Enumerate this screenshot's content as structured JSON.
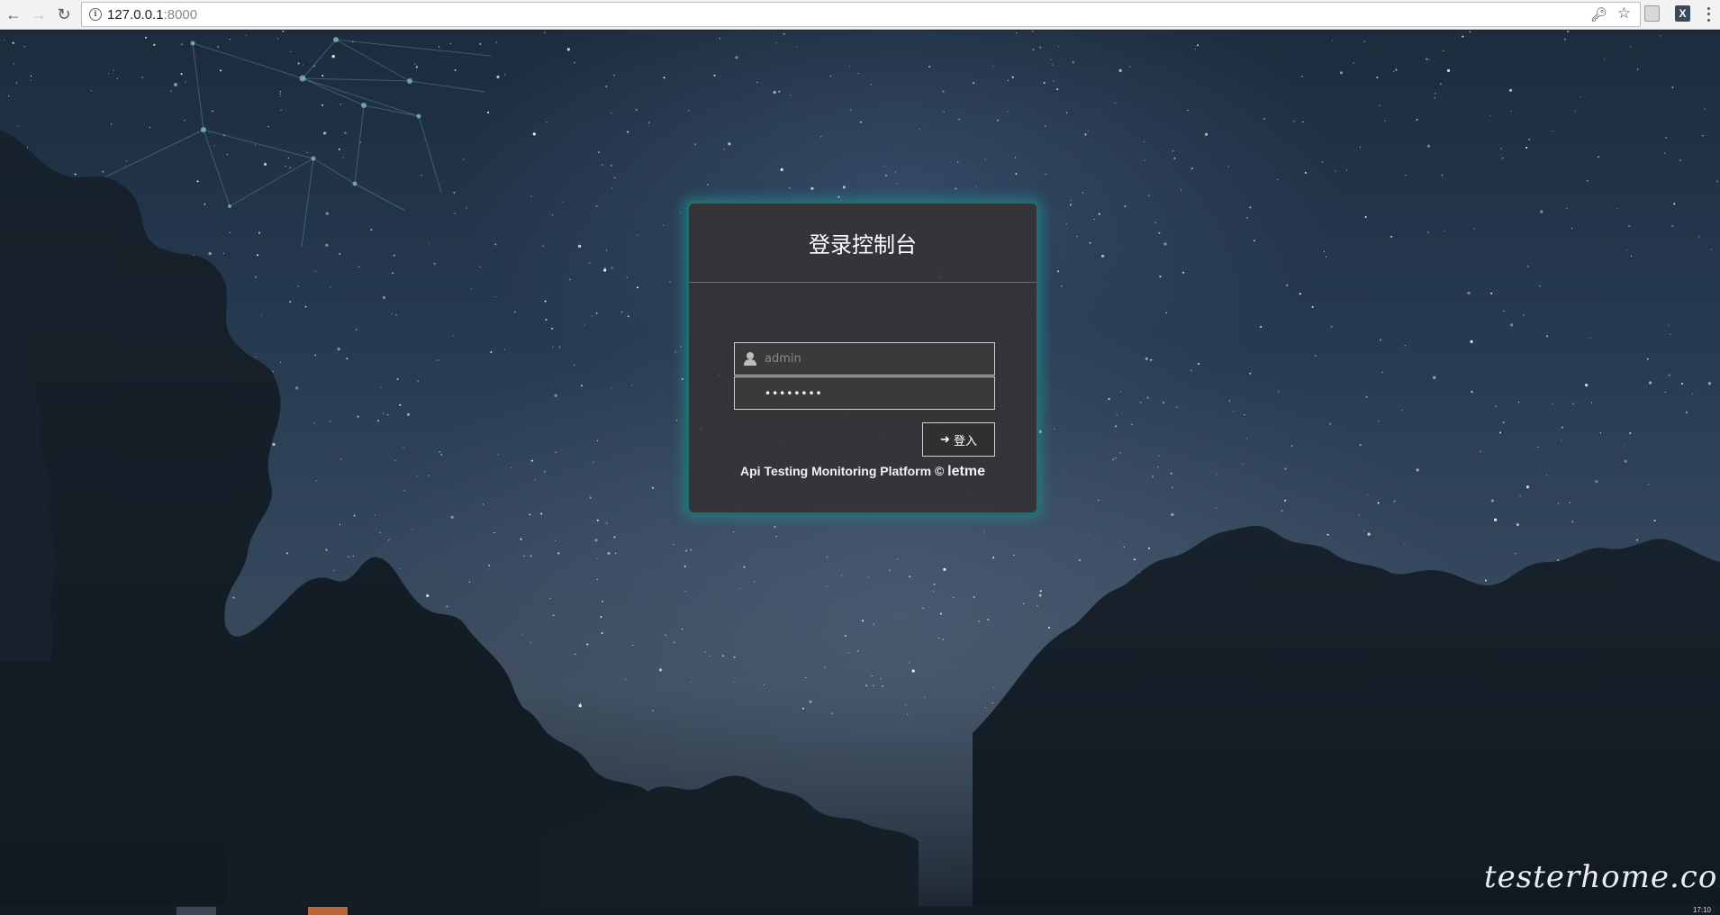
{
  "browser": {
    "url_host": "127.0.0.1",
    "url_port": ":8000",
    "info_icon_glyph": "i",
    "ext_icon_x": "X"
  },
  "login": {
    "title": "登录控制台",
    "username_value": "",
    "username_placeholder": "admin",
    "password_value": "••••••••",
    "button_label": "登入",
    "footer_text": "Api Testing Monitoring Platform © ",
    "footer_brand": "letme"
  },
  "watermark": "testerhome.com",
  "taskbar": {
    "clock": "17:10"
  },
  "colors": {
    "panel_border": "#1f6f70",
    "panel_glow": "#2096a0",
    "panel_bg": "#343436",
    "sky_top": "#1d2c3d",
    "tree_dark": "#152029"
  },
  "icons": {
    "back": "arrow-left-icon",
    "forward": "arrow-right-icon",
    "reload": "reload-icon",
    "info": "info-icon",
    "key": "key-icon",
    "star": "star-icon",
    "user": "user-icon",
    "login": "sign-in-icon"
  }
}
